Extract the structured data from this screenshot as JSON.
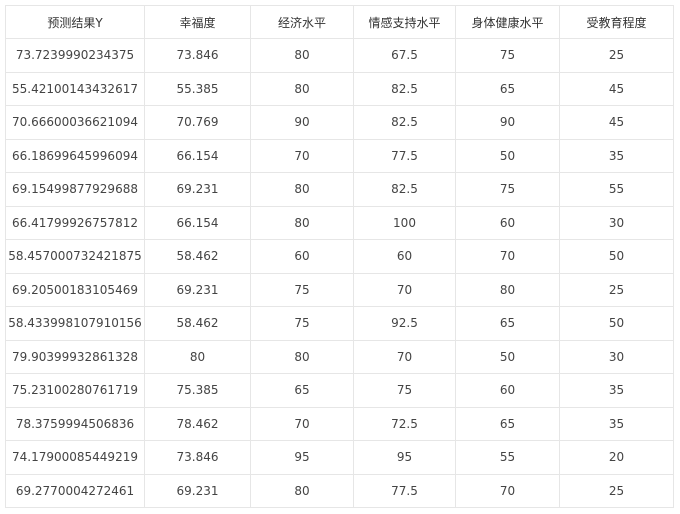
{
  "table": {
    "headers": [
      "预测结果Y",
      "幸福度",
      "经济水平",
      "情感支持水平",
      "身体健康水平",
      "受教育程度"
    ],
    "rows": [
      [
        "73.7239990234375",
        "73.846",
        "80",
        "67.5",
        "75",
        "25"
      ],
      [
        "55.42100143432617",
        "55.385",
        "80",
        "82.5",
        "65",
        "45"
      ],
      [
        "70.66600036621094",
        "70.769",
        "90",
        "82.5",
        "90",
        "45"
      ],
      [
        "66.18699645996094",
        "66.154",
        "70",
        "77.5",
        "50",
        "35"
      ],
      [
        "69.15499877929688",
        "69.231",
        "80",
        "82.5",
        "75",
        "55"
      ],
      [
        "66.41799926757812",
        "66.154",
        "80",
        "100",
        "60",
        "30"
      ],
      [
        "58.457000732421875",
        "58.462",
        "60",
        "60",
        "70",
        "50"
      ],
      [
        "69.20500183105469",
        "69.231",
        "75",
        "70",
        "80",
        "25"
      ],
      [
        "58.433998107910156",
        "58.462",
        "75",
        "92.5",
        "65",
        "50"
      ],
      [
        "79.90399932861328",
        "80",
        "80",
        "70",
        "50",
        "30"
      ],
      [
        "75.23100280761719",
        "75.385",
        "65",
        "75",
        "60",
        "35"
      ],
      [
        "78.3759994506836",
        "78.462",
        "70",
        "72.5",
        "65",
        "35"
      ],
      [
        "74.17900085449219",
        "73.846",
        "95",
        "95",
        "55",
        "20"
      ],
      [
        "69.2770004272461",
        "69.231",
        "80",
        "77.5",
        "70",
        "25"
      ]
    ]
  }
}
